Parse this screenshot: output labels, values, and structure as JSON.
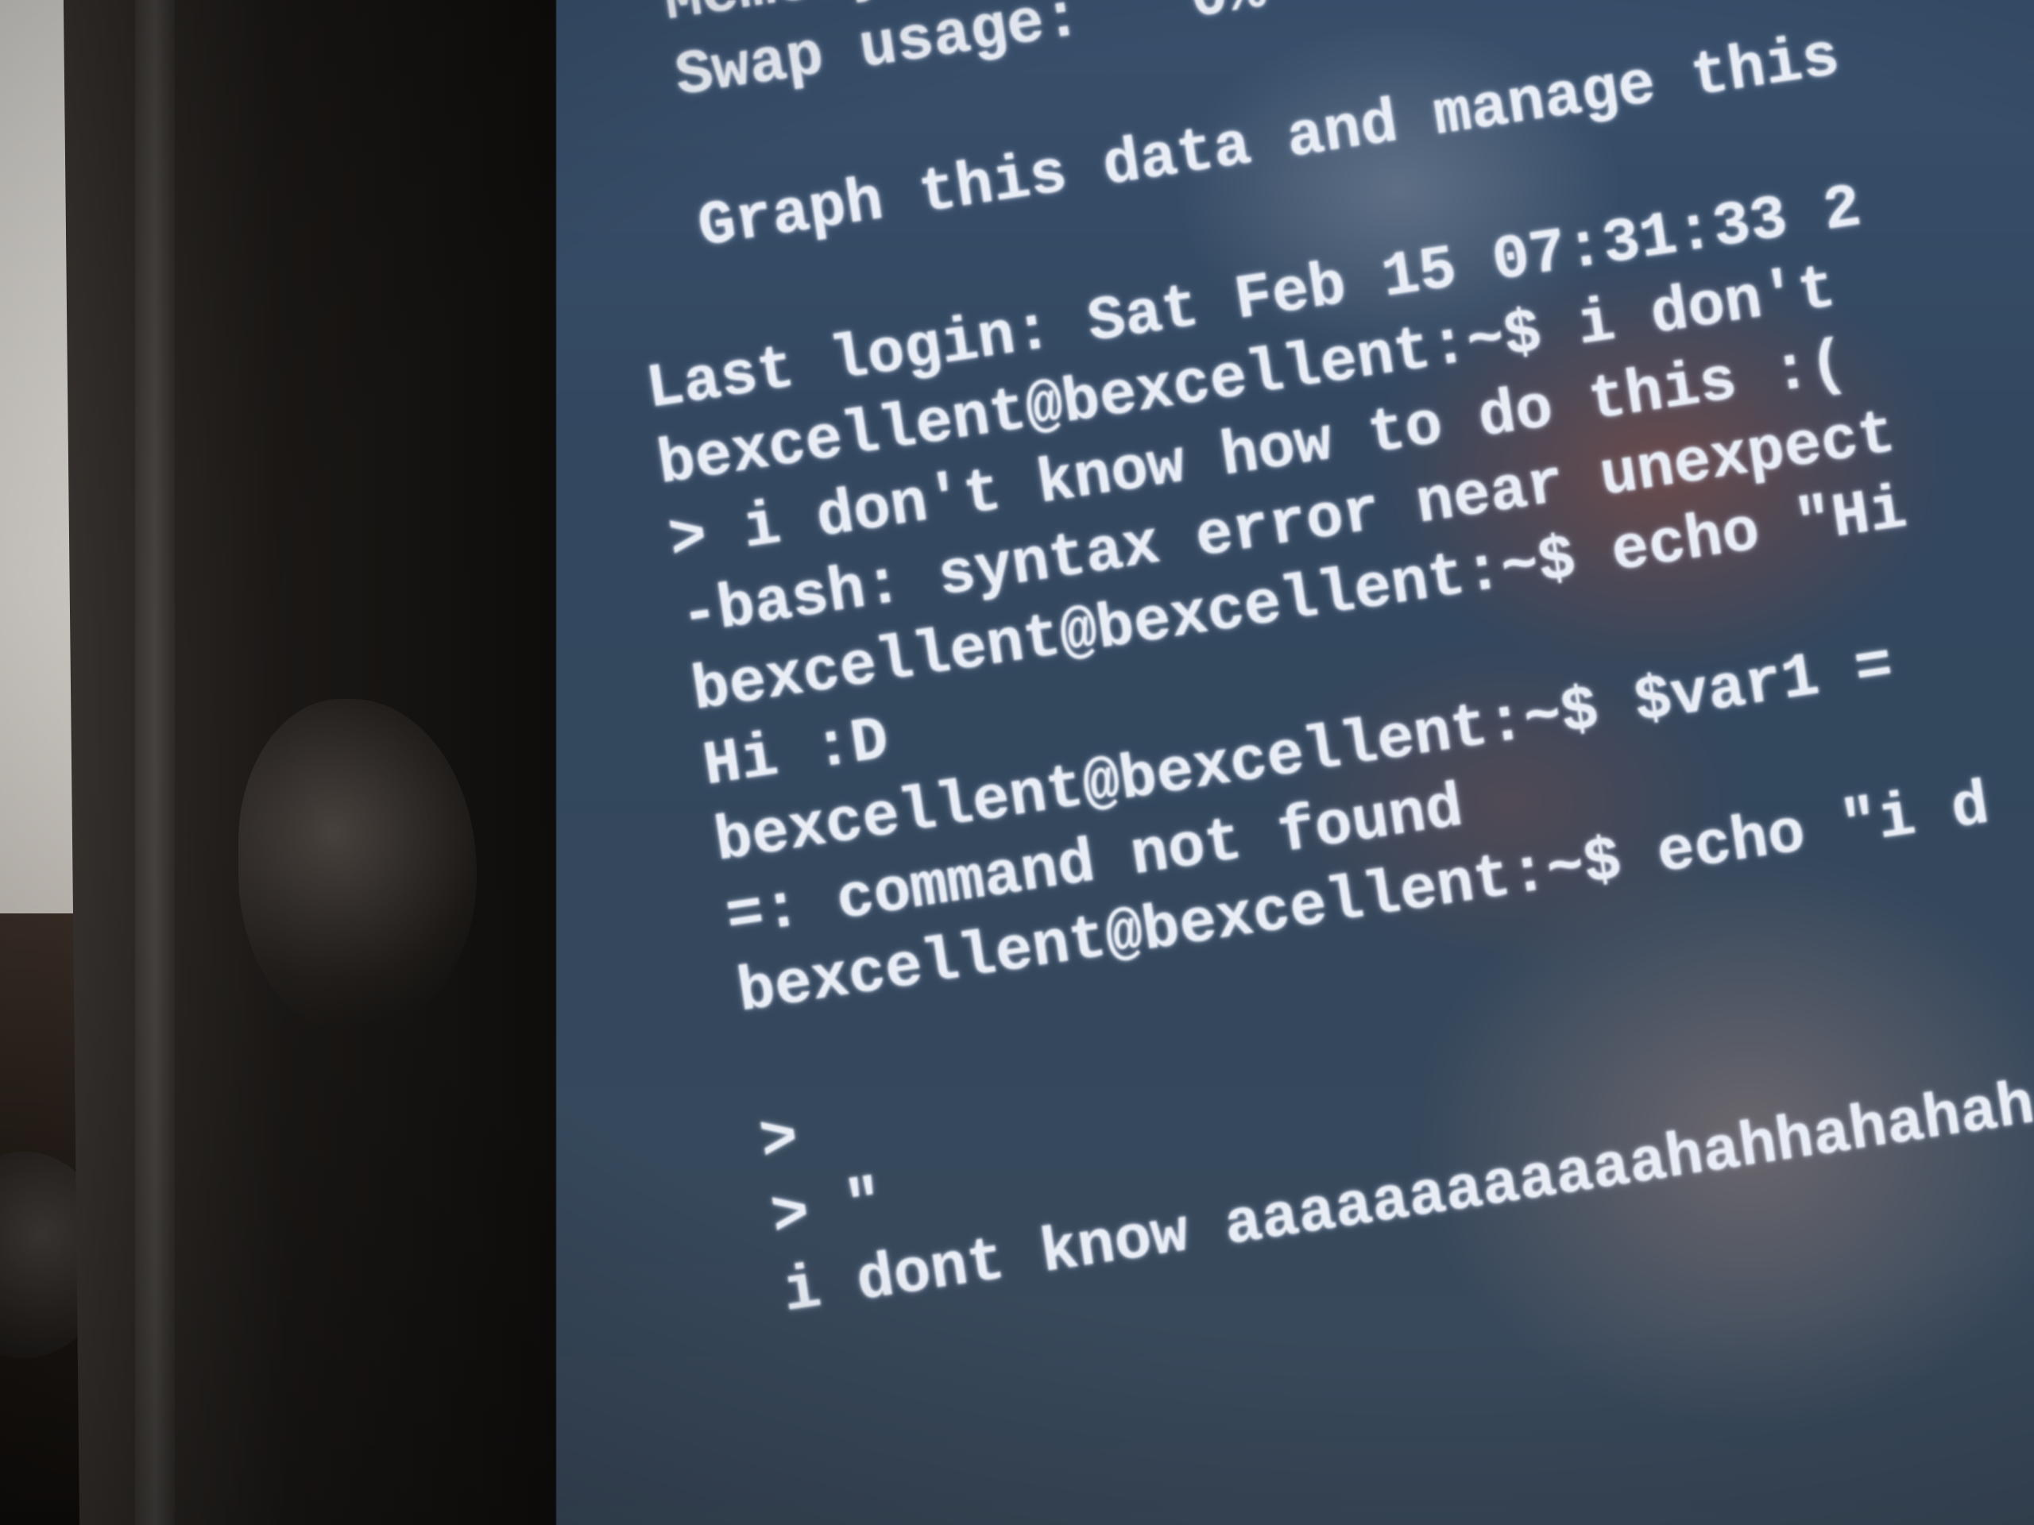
{
  "terminal": {
    "lines": [
      "Memory usage:",
      "Swap usage:   0%",
      "",
      "Graph this data and manage this",
      "",
      "Last login: Sat Feb 15 07:31:33 2",
      "bexcellent@bexcellent:~$ i don't",
      "> i don't know how to do this :(",
      "-bash: syntax error near unexpect",
      "bexcellent@bexcellent:~$ echo \"Hi",
      "Hi :D",
      "bexcellent@bexcellent:~$ $var1 = ",
      "=: command not found",
      "bexcellent@bexcellent:~$ echo \"i d",
      ">",
      "> \"",
      "i dont know aaaaaaaaaaaahahhahahah"
    ]
  }
}
